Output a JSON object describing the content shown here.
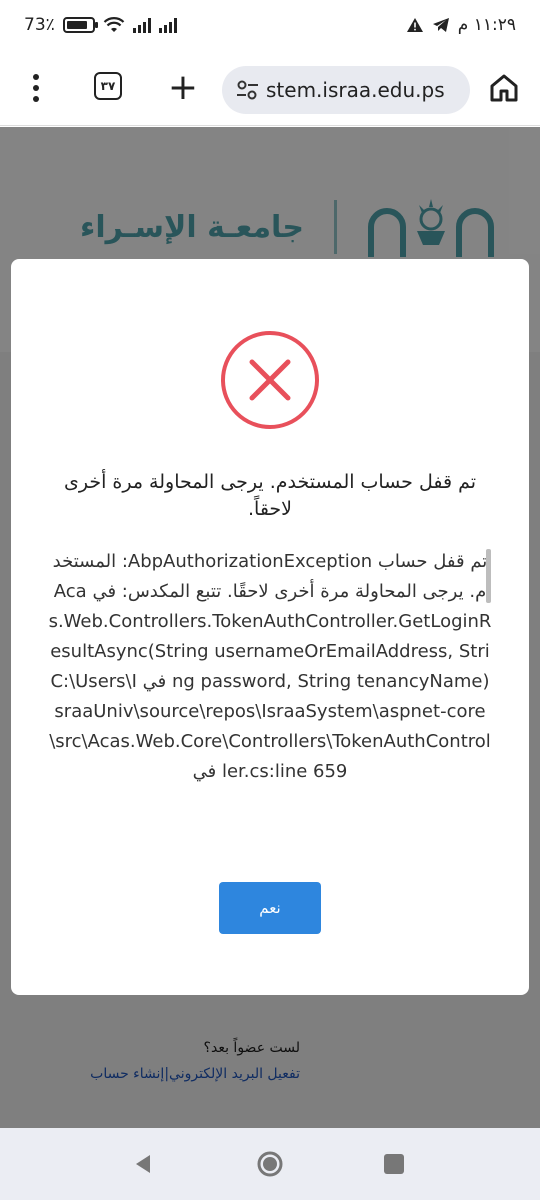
{
  "status_bar": {
    "battery_text": "73٪",
    "time": "١١:٢٩ م"
  },
  "browser": {
    "tab_count": "٣٧",
    "url": "stem.israa.edu.ps",
    "new_tab_symbol": "+"
  },
  "page": {
    "logo_text": "جامعـة الإسـراء",
    "footer_question": "لست عضواً بعد؟",
    "footer_link_activate": "تفعيل البريد الإلكتروني",
    "footer_link_separator": "|",
    "footer_link_create": "إنشاء حساب"
  },
  "modal": {
    "title": "تم قفل حساب المستخدم. يرجى المحاولة مرة أخرى لاحقاً.",
    "body": "تم قفل حساب AbpAuthorizationException: المستخدم. يرجى المحاولة مرة أخرى لاحقًا. تتبع المكدس: في Acas.Web.Controllers.TokenAuthController.GetLoginResultAsync(String usernameOrEmailAddress, String password, String tenancyName) في C:\\Users\\IsraaUniv\\source\\repos\\IsraaSystem\\aspnet-core\\src\\Acas.Web.Core\\Controllers\\TokenAuthController.cs:line 659 في",
    "ok_label": "نعم"
  },
  "colors": {
    "error_red": "#e8505b",
    "button_blue": "#2e86de",
    "logo_teal": "#2d5d62"
  },
  "icons": {
    "error": "x-circle-icon",
    "home": "home-icon",
    "site_settings": "tune-icon"
  }
}
